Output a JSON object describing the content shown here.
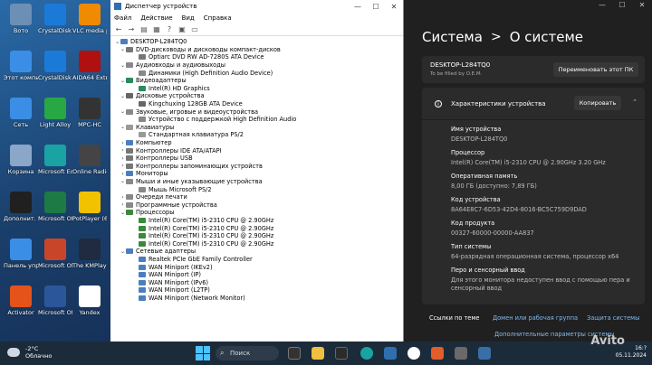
{
  "desktop": {
    "icons": [
      {
        "label": "Boтo",
        "color": "#6b8fb5"
      },
      {
        "label": "CrystalDisk Shedkin",
        "color": "#1b7ad8"
      },
      {
        "label": "VLC media player",
        "color": "#f08a00"
      },
      {
        "label": "Этот компьютер",
        "color": "#3a8ee6"
      },
      {
        "label": "CrystalDisk Info",
        "color": "#1b7ad8"
      },
      {
        "label": "AIDA64 Extreme",
        "color": "#b01010"
      },
      {
        "label": "Сеть",
        "color": "#3a8ee6"
      },
      {
        "label": "Light Alloy",
        "color": "#28a745"
      },
      {
        "label": "MPC-HC",
        "color": "#333333"
      },
      {
        "label": "Корзина",
        "color": "#8aa6c8"
      },
      {
        "label": "Microsoft Edge",
        "color": "#1aa3a3"
      },
      {
        "label": "Online Radio",
        "color": "#444444"
      },
      {
        "label": "Дополнит. сведения...",
        "color": "#202020"
      },
      {
        "label": "Microsoft Office Exc...",
        "color": "#1d7a44"
      },
      {
        "label": "PotPlayer (64-bit)",
        "color": "#f2c200"
      },
      {
        "label": "Панель управления",
        "color": "#3a8ee6"
      },
      {
        "label": "Microsoft Office Po...",
        "color": "#c9452a"
      },
      {
        "label": "The KMPlayer",
        "color": "#202a40"
      },
      {
        "label": "Activator",
        "color": "#e5531a"
      },
      {
        "label": "Microsoft Office Wo...",
        "color": "#2b579a"
      },
      {
        "label": "Yandex",
        "color": "#ffffff"
      }
    ]
  },
  "devmgr": {
    "title": "Диспетчер устройств",
    "menu": [
      "Файл",
      "Действие",
      "Вид",
      "Справка"
    ],
    "tree": [
      {
        "level": 0,
        "exp": "v",
        "label": "DESKTOP-L284TQ0",
        "color": "#4a7fbf"
      },
      {
        "level": 1,
        "exp": "v",
        "label": "DVD-дисководы и дисководы компакт-дисков",
        "color": "#777777"
      },
      {
        "level": 2,
        "exp": "",
        "label": "Optiarc DVD RW AD-7280S ATA Device",
        "color": "#777777"
      },
      {
        "level": 1,
        "exp": "v",
        "label": "Аудиовходы и аудиовыходы",
        "color": "#888888"
      },
      {
        "level": 2,
        "exp": "",
        "label": "Динамики (High Definition Audio Device)",
        "color": "#888888"
      },
      {
        "level": 1,
        "exp": "v",
        "label": "Видеоадаптеры",
        "color": "#2a8a5a"
      },
      {
        "level": 2,
        "exp": "",
        "label": "Intel(R) HD Graphics",
        "color": "#2a8a5a"
      },
      {
        "level": 1,
        "exp": "v",
        "label": "Дисковые устройства",
        "color": "#666666"
      },
      {
        "level": 2,
        "exp": "",
        "label": "Kingchuxing 128GB ATA Device",
        "color": "#666666"
      },
      {
        "level": 1,
        "exp": "v",
        "label": "Звуковые, игровые и видеоустройства",
        "color": "#888888"
      },
      {
        "level": 2,
        "exp": "",
        "label": "Устройство с поддержкой High Definition Audio",
        "color": "#888888"
      },
      {
        "level": 1,
        "exp": "v",
        "label": "Клавиатуры",
        "color": "#999999"
      },
      {
        "level": 2,
        "exp": "",
        "label": "Стандартная клавиатура PS/2",
        "color": "#999999"
      },
      {
        "level": 1,
        "exp": ">",
        "label": "Компьютер",
        "color": "#4a7fbf"
      },
      {
        "level": 1,
        "exp": ">",
        "label": "Контроллеры IDE ATA/ATAPI",
        "color": "#777777"
      },
      {
        "level": 1,
        "exp": ">",
        "label": "Контроллеры USB",
        "color": "#777777"
      },
      {
        "level": 1,
        "exp": ">",
        "label": "Контроллеры запоминающих устройств",
        "color": "#777777"
      },
      {
        "level": 1,
        "exp": ">",
        "label": "Мониторы",
        "color": "#4a7fbf"
      },
      {
        "level": 1,
        "exp": "v",
        "label": "Мыши и иные указывающие устройства",
        "color": "#888888"
      },
      {
        "level": 2,
        "exp": "",
        "label": "Мышь Microsoft PS/2",
        "color": "#888888"
      },
      {
        "level": 1,
        "exp": ">",
        "label": "Очереди печати",
        "color": "#888888"
      },
      {
        "level": 1,
        "exp": ">",
        "label": "Программные устройства",
        "color": "#888888"
      },
      {
        "level": 1,
        "exp": "v",
        "label": "Процессоры",
        "color": "#3a8a3a"
      },
      {
        "level": 2,
        "exp": "",
        "label": "Intel(R) Core(TM) i5-2310 CPU @ 2.90GHz",
        "color": "#3a8a3a"
      },
      {
        "level": 2,
        "exp": "",
        "label": "Intel(R) Core(TM) i5-2310 CPU @ 2.90GHz",
        "color": "#3a8a3a"
      },
      {
        "level": 2,
        "exp": "",
        "label": "Intel(R) Core(TM) i5-2310 CPU @ 2.90GHz",
        "color": "#3a8a3a"
      },
      {
        "level": 2,
        "exp": "",
        "label": "Intel(R) Core(TM) i5-2310 CPU @ 2.90GHz",
        "color": "#3a8a3a"
      },
      {
        "level": 1,
        "exp": "v",
        "label": "Сетевые адаптеры",
        "color": "#4a7fbf"
      },
      {
        "level": 2,
        "exp": "",
        "label": "Realtek PCIe GbE Family Controller",
        "color": "#4a7fbf"
      },
      {
        "level": 2,
        "exp": "",
        "label": "WAN Miniport (IKEv2)",
        "color": "#4a7fbf"
      },
      {
        "level": 2,
        "exp": "",
        "label": "WAN Miniport (IP)",
        "color": "#4a7fbf"
      },
      {
        "level": 2,
        "exp": "",
        "label": "WAN Miniport (IPv6)",
        "color": "#4a7fbf"
      },
      {
        "level": 2,
        "exp": "",
        "label": "WAN Miniport (L2TP)",
        "color": "#4a7fbf"
      },
      {
        "level": 2,
        "exp": "",
        "label": "WAN Miniport (Network Monitor)",
        "color": "#4a7fbf"
      }
    ]
  },
  "settings": {
    "breadcrumb_parent": "Система",
    "breadcrumb_sep": ">",
    "breadcrumb_current": "О системе",
    "pc_name": "DESKTOP-L284TQ0",
    "pc_sub": "To be filled by O.E.M.",
    "rename_label": "Переименовать этот ПК",
    "spec_title": "Характеристики устройства",
    "copy_label": "Копировать",
    "specs": [
      {
        "label": "Имя устройства",
        "value": "DESKTOP-L284TQ0"
      },
      {
        "label": "Процессор",
        "value": "Intel(R) Core(TM) i5-2310 CPU @ 2.90GHz   3.20 GHz"
      },
      {
        "label": "Оперативная память",
        "value": "8,00 ГБ (доступно: 7,89 ГБ)"
      },
      {
        "label": "Код устройства",
        "value": "8A64E8C7-6D53-42D4-8016-BC5C759D9DAD"
      },
      {
        "label": "Код продукта",
        "value": "00327-60000-00000-AA837"
      },
      {
        "label": "Тип системы",
        "value": "64-разрядная операционная система, процессор x64"
      },
      {
        "label": "Перо и сенсорный ввод",
        "value": "Для этого монитора недоступен ввод с помощью пера и сенсорный ввод"
      }
    ],
    "links_label": "Ссылки по теме",
    "link_domain": "Домен или рабочая группа",
    "link_protection": "Защита системы",
    "link_advanced": "Дополнительные параметры системы"
  },
  "taskbar": {
    "temp": "-2°C",
    "weather": "Облачно",
    "search": "Поиск",
    "time": "16:?",
    "date": "05.11.2024"
  },
  "watermark": "Avito"
}
